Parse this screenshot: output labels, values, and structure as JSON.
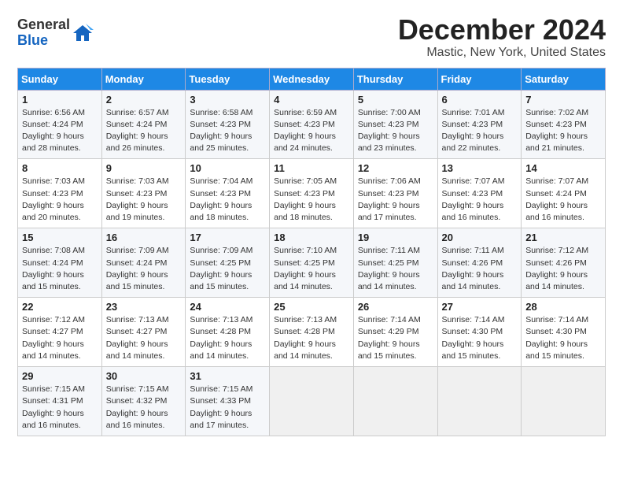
{
  "header": {
    "logo_general": "General",
    "logo_blue": "Blue",
    "title": "December 2024",
    "subtitle": "Mastic, New York, United States"
  },
  "days_of_week": [
    "Sunday",
    "Monday",
    "Tuesday",
    "Wednesday",
    "Thursday",
    "Friday",
    "Saturday"
  ],
  "weeks": [
    [
      {
        "day": "1",
        "sunrise": "6:56 AM",
        "sunset": "4:24 PM",
        "daylight": "9 hours and 28 minutes."
      },
      {
        "day": "2",
        "sunrise": "6:57 AM",
        "sunset": "4:24 PM",
        "daylight": "9 hours and 26 minutes."
      },
      {
        "day": "3",
        "sunrise": "6:58 AM",
        "sunset": "4:23 PM",
        "daylight": "9 hours and 25 minutes."
      },
      {
        "day": "4",
        "sunrise": "6:59 AM",
        "sunset": "4:23 PM",
        "daylight": "9 hours and 24 minutes."
      },
      {
        "day": "5",
        "sunrise": "7:00 AM",
        "sunset": "4:23 PM",
        "daylight": "9 hours and 23 minutes."
      },
      {
        "day": "6",
        "sunrise": "7:01 AM",
        "sunset": "4:23 PM",
        "daylight": "9 hours and 22 minutes."
      },
      {
        "day": "7",
        "sunrise": "7:02 AM",
        "sunset": "4:23 PM",
        "daylight": "9 hours and 21 minutes."
      }
    ],
    [
      {
        "day": "8",
        "sunrise": "7:03 AM",
        "sunset": "4:23 PM",
        "daylight": "9 hours and 20 minutes."
      },
      {
        "day": "9",
        "sunrise": "7:03 AM",
        "sunset": "4:23 PM",
        "daylight": "9 hours and 19 minutes."
      },
      {
        "day": "10",
        "sunrise": "7:04 AM",
        "sunset": "4:23 PM",
        "daylight": "9 hours and 18 minutes."
      },
      {
        "day": "11",
        "sunrise": "7:05 AM",
        "sunset": "4:23 PM",
        "daylight": "9 hours and 18 minutes."
      },
      {
        "day": "12",
        "sunrise": "7:06 AM",
        "sunset": "4:23 PM",
        "daylight": "9 hours and 17 minutes."
      },
      {
        "day": "13",
        "sunrise": "7:07 AM",
        "sunset": "4:23 PM",
        "daylight": "9 hours and 16 minutes."
      },
      {
        "day": "14",
        "sunrise": "7:07 AM",
        "sunset": "4:24 PM",
        "daylight": "9 hours and 16 minutes."
      }
    ],
    [
      {
        "day": "15",
        "sunrise": "7:08 AM",
        "sunset": "4:24 PM",
        "daylight": "9 hours and 15 minutes."
      },
      {
        "day": "16",
        "sunrise": "7:09 AM",
        "sunset": "4:24 PM",
        "daylight": "9 hours and 15 minutes."
      },
      {
        "day": "17",
        "sunrise": "7:09 AM",
        "sunset": "4:25 PM",
        "daylight": "9 hours and 15 minutes."
      },
      {
        "day": "18",
        "sunrise": "7:10 AM",
        "sunset": "4:25 PM",
        "daylight": "9 hours and 14 minutes."
      },
      {
        "day": "19",
        "sunrise": "7:11 AM",
        "sunset": "4:25 PM",
        "daylight": "9 hours and 14 minutes."
      },
      {
        "day": "20",
        "sunrise": "7:11 AM",
        "sunset": "4:26 PM",
        "daylight": "9 hours and 14 minutes."
      },
      {
        "day": "21",
        "sunrise": "7:12 AM",
        "sunset": "4:26 PM",
        "daylight": "9 hours and 14 minutes."
      }
    ],
    [
      {
        "day": "22",
        "sunrise": "7:12 AM",
        "sunset": "4:27 PM",
        "daylight": "9 hours and 14 minutes."
      },
      {
        "day": "23",
        "sunrise": "7:13 AM",
        "sunset": "4:27 PM",
        "daylight": "9 hours and 14 minutes."
      },
      {
        "day": "24",
        "sunrise": "7:13 AM",
        "sunset": "4:28 PM",
        "daylight": "9 hours and 14 minutes."
      },
      {
        "day": "25",
        "sunrise": "7:13 AM",
        "sunset": "4:28 PM",
        "daylight": "9 hours and 14 minutes."
      },
      {
        "day": "26",
        "sunrise": "7:14 AM",
        "sunset": "4:29 PM",
        "daylight": "9 hours and 15 minutes."
      },
      {
        "day": "27",
        "sunrise": "7:14 AM",
        "sunset": "4:30 PM",
        "daylight": "9 hours and 15 minutes."
      },
      {
        "day": "28",
        "sunrise": "7:14 AM",
        "sunset": "4:30 PM",
        "daylight": "9 hours and 15 minutes."
      }
    ],
    [
      {
        "day": "29",
        "sunrise": "7:15 AM",
        "sunset": "4:31 PM",
        "daylight": "9 hours and 16 minutes."
      },
      {
        "day": "30",
        "sunrise": "7:15 AM",
        "sunset": "4:32 PM",
        "daylight": "9 hours and 16 minutes."
      },
      {
        "day": "31",
        "sunrise": "7:15 AM",
        "sunset": "4:33 PM",
        "daylight": "9 hours and 17 minutes."
      },
      {
        "day": "",
        "sunrise": "",
        "sunset": "",
        "daylight": ""
      },
      {
        "day": "",
        "sunrise": "",
        "sunset": "",
        "daylight": ""
      },
      {
        "day": "",
        "sunrise": "",
        "sunset": "",
        "daylight": ""
      },
      {
        "day": "",
        "sunrise": "",
        "sunset": "",
        "daylight": ""
      }
    ]
  ]
}
